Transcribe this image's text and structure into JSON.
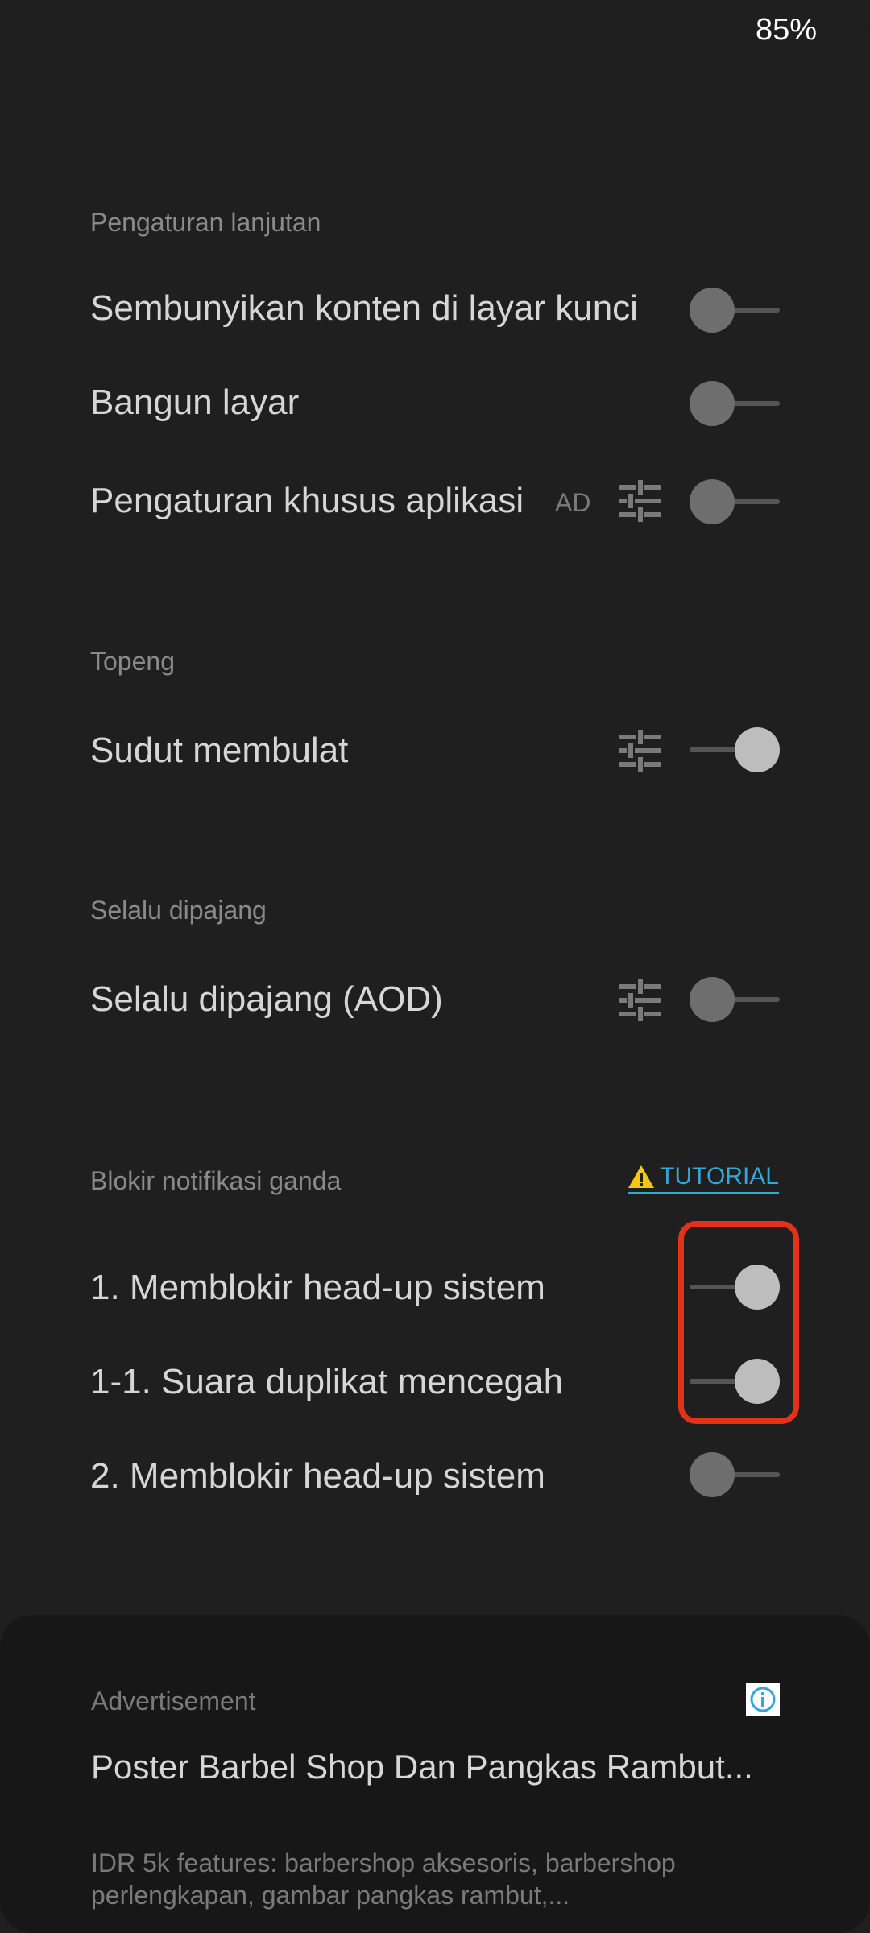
{
  "status_bar": {
    "battery": "85%"
  },
  "sections": {
    "advanced": {
      "header": "Pengaturan lanjutan",
      "hide_lock_content": {
        "label": "Sembunyikan konten di layar kunci",
        "enabled": false
      },
      "wake_screen": {
        "label": "Bangun layar",
        "enabled": false
      },
      "app_specific": {
        "label": "Pengaturan khusus aplikasi",
        "badge": "AD",
        "enabled": false
      }
    },
    "mask": {
      "header": "Topeng",
      "rounded_corners": {
        "label": "Sudut membulat",
        "enabled": true
      }
    },
    "always_on": {
      "header": "Selalu dipajang",
      "aod": {
        "label": "Selalu dipajang (AOD)",
        "enabled": false
      }
    },
    "block_duplicate": {
      "header": "Blokir notifikasi ganda",
      "tutorial_label": "TUTORIAL",
      "block_headsup_1": {
        "label": "1. Memblokir head-up sistem",
        "enabled": true
      },
      "prevent_duplicate_sound": {
        "label": "1-1. Suara duplikat mencegah",
        "enabled": true
      },
      "block_headsup_2": {
        "label": "2. Memblokir head-up sistem",
        "enabled": false
      }
    }
  },
  "advertisement": {
    "label": "Advertisement",
    "title": "Poster Barbel Shop Dan Pangkas Rambut...",
    "description": "IDR 5k features: barbershop aksesoris, barbershop perlengkapan, gambar pangkas rambut,..."
  },
  "colors": {
    "background": "#1f1f1f",
    "highlight": "#e5301a",
    "link": "#33a7d6",
    "warning": "#f5c518"
  }
}
